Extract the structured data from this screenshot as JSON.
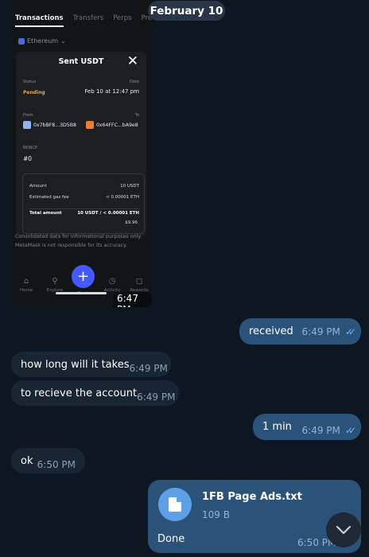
{
  "date_separator": "February 10",
  "screenshot": {
    "tabs": [
      "Transactions",
      "Transfers",
      "Perps",
      "Pred"
    ],
    "network": "Ethereum",
    "modal": {
      "title": "Sent USDT",
      "status_label": "Status",
      "status_value": "Pending",
      "date_label": "Date",
      "date_value": "Feb 10 at 12:47 pm",
      "from_label": "From",
      "from_address": "0x7bBF8...3D5B8",
      "to_label": "To",
      "to_address": "0x64FFC...bA9e8",
      "nonce_label": "NONCE",
      "nonce_value": "#0",
      "amount_label": "Amount",
      "amount_value": "10 USDT",
      "gas_label": "Estimated gas fee",
      "gas_value": "< 0.00001 ETH",
      "total_label": "Total amount",
      "total_value": "10 USDT / < 0.00001 ETH",
      "total_usd": "$9.96"
    },
    "disclaimer": "Consolidated data for informational purposes only. MetaMask is not responsible for its accuracy.",
    "nav": [
      "Home",
      "Explore",
      "Trade",
      "Activity",
      "Rewards"
    ],
    "time": "6:47 PM"
  },
  "messages": [
    {
      "text": "received",
      "time": "6:49 PM",
      "direction": "out",
      "read": true
    },
    {
      "text": "how long will it takes",
      "time": "6:49 PM",
      "direction": "in"
    },
    {
      "text": "to recieve the account",
      "time": "6:49 PM",
      "direction": "in"
    },
    {
      "text": "1 min",
      "time": "6:49 PM",
      "direction": "out",
      "read": true
    },
    {
      "text": "ok",
      "time": "6:50 PM",
      "direction": "in"
    }
  ],
  "file_message": {
    "filename": "1FB Page Ads.txt",
    "size": "109 B",
    "caption": "Done",
    "time": "6:50 PM"
  },
  "colors": {
    "background": "#0e1621",
    "incoming_bubble": "#182533",
    "outgoing_bubble": "#2b5278",
    "read_check": "#6fb3ff",
    "pending": "#f0a73b",
    "trade_button": "#4459ff"
  },
  "icons": [
    "double-check-icon",
    "file-icon",
    "chevron-down-icon",
    "close-icon",
    "plus-icon"
  ]
}
